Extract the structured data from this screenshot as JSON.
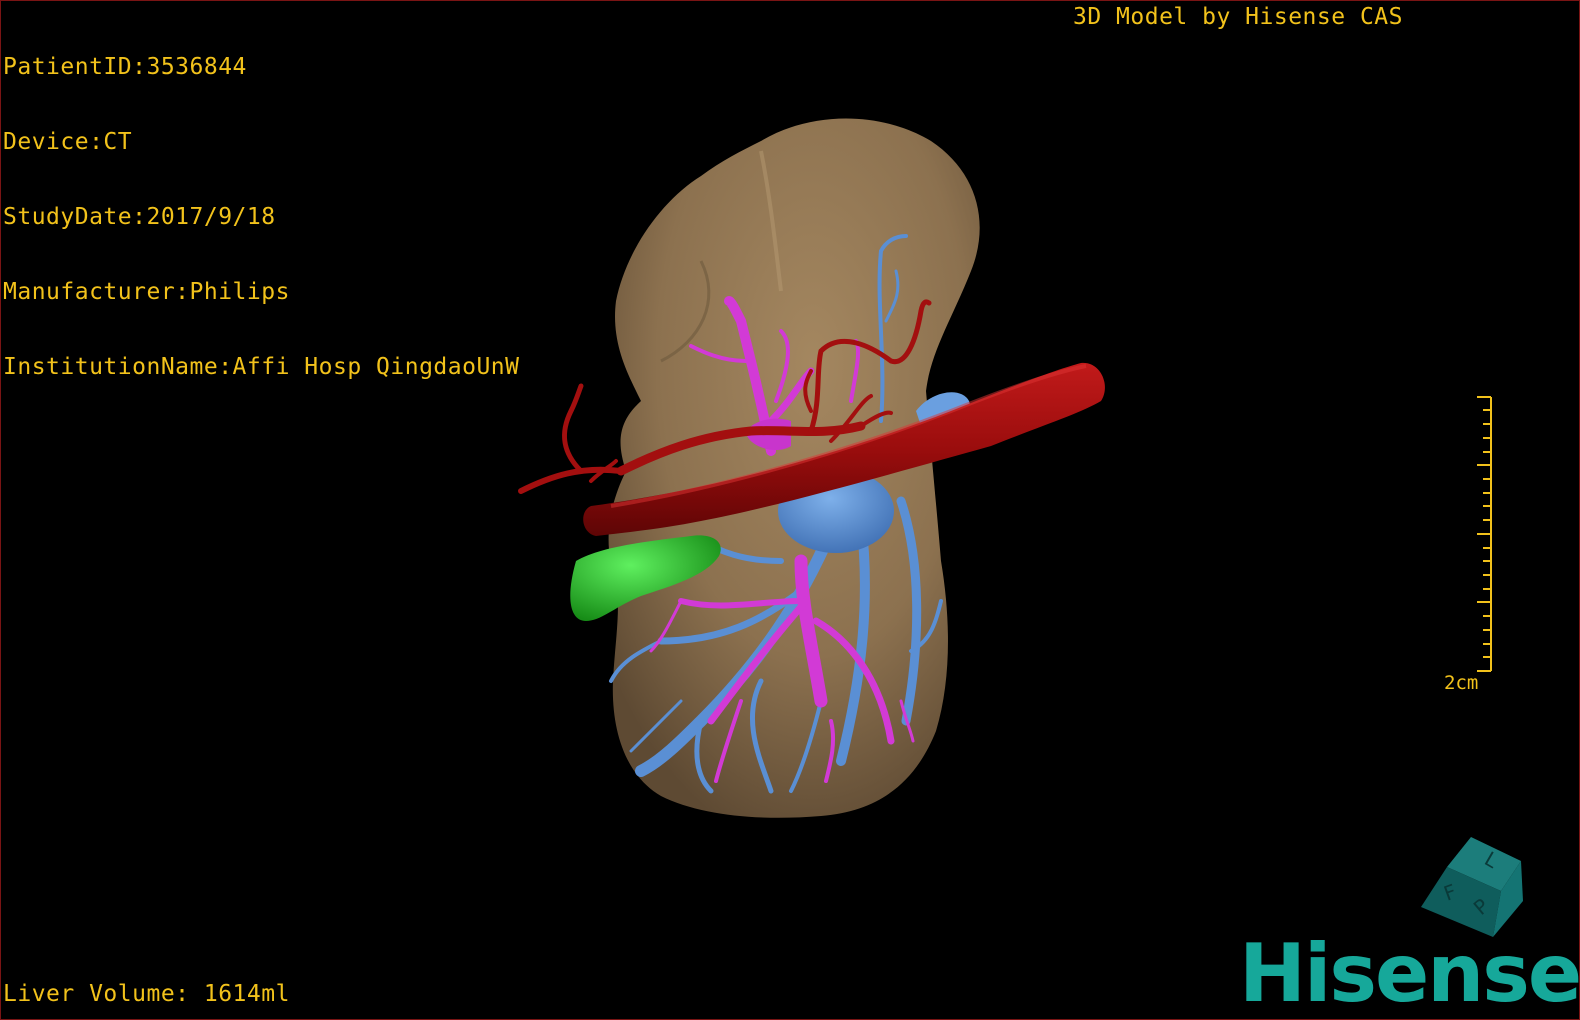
{
  "header": {
    "patient_id": "PatientID:3536844",
    "device": "Device:CT",
    "study_date": "StudyDate:2017/9/18",
    "manufacturer": "Manufacturer:Philips",
    "institution": "InstitutionName:Affi Hosp QingdaoUnW",
    "credit": "3D Model by Hisense CAS"
  },
  "footer": {
    "liver_volume": "Liver Volume: 1614ml"
  },
  "scale_bar": {
    "label": "2cm"
  },
  "orientation_cube": {
    "face_labels": [
      "F",
      "L",
      "P"
    ]
  },
  "logo": {
    "text": "Hisense"
  },
  "colors": {
    "overlay_text": "#f2c21b",
    "liver": "#8f7350",
    "artery": "#a30f0f",
    "portal_vein": "#d23ad6",
    "hepatic_vein": "#5a8fd4",
    "gallbladder": "#2ec42e",
    "logo": "#16a89a"
  }
}
